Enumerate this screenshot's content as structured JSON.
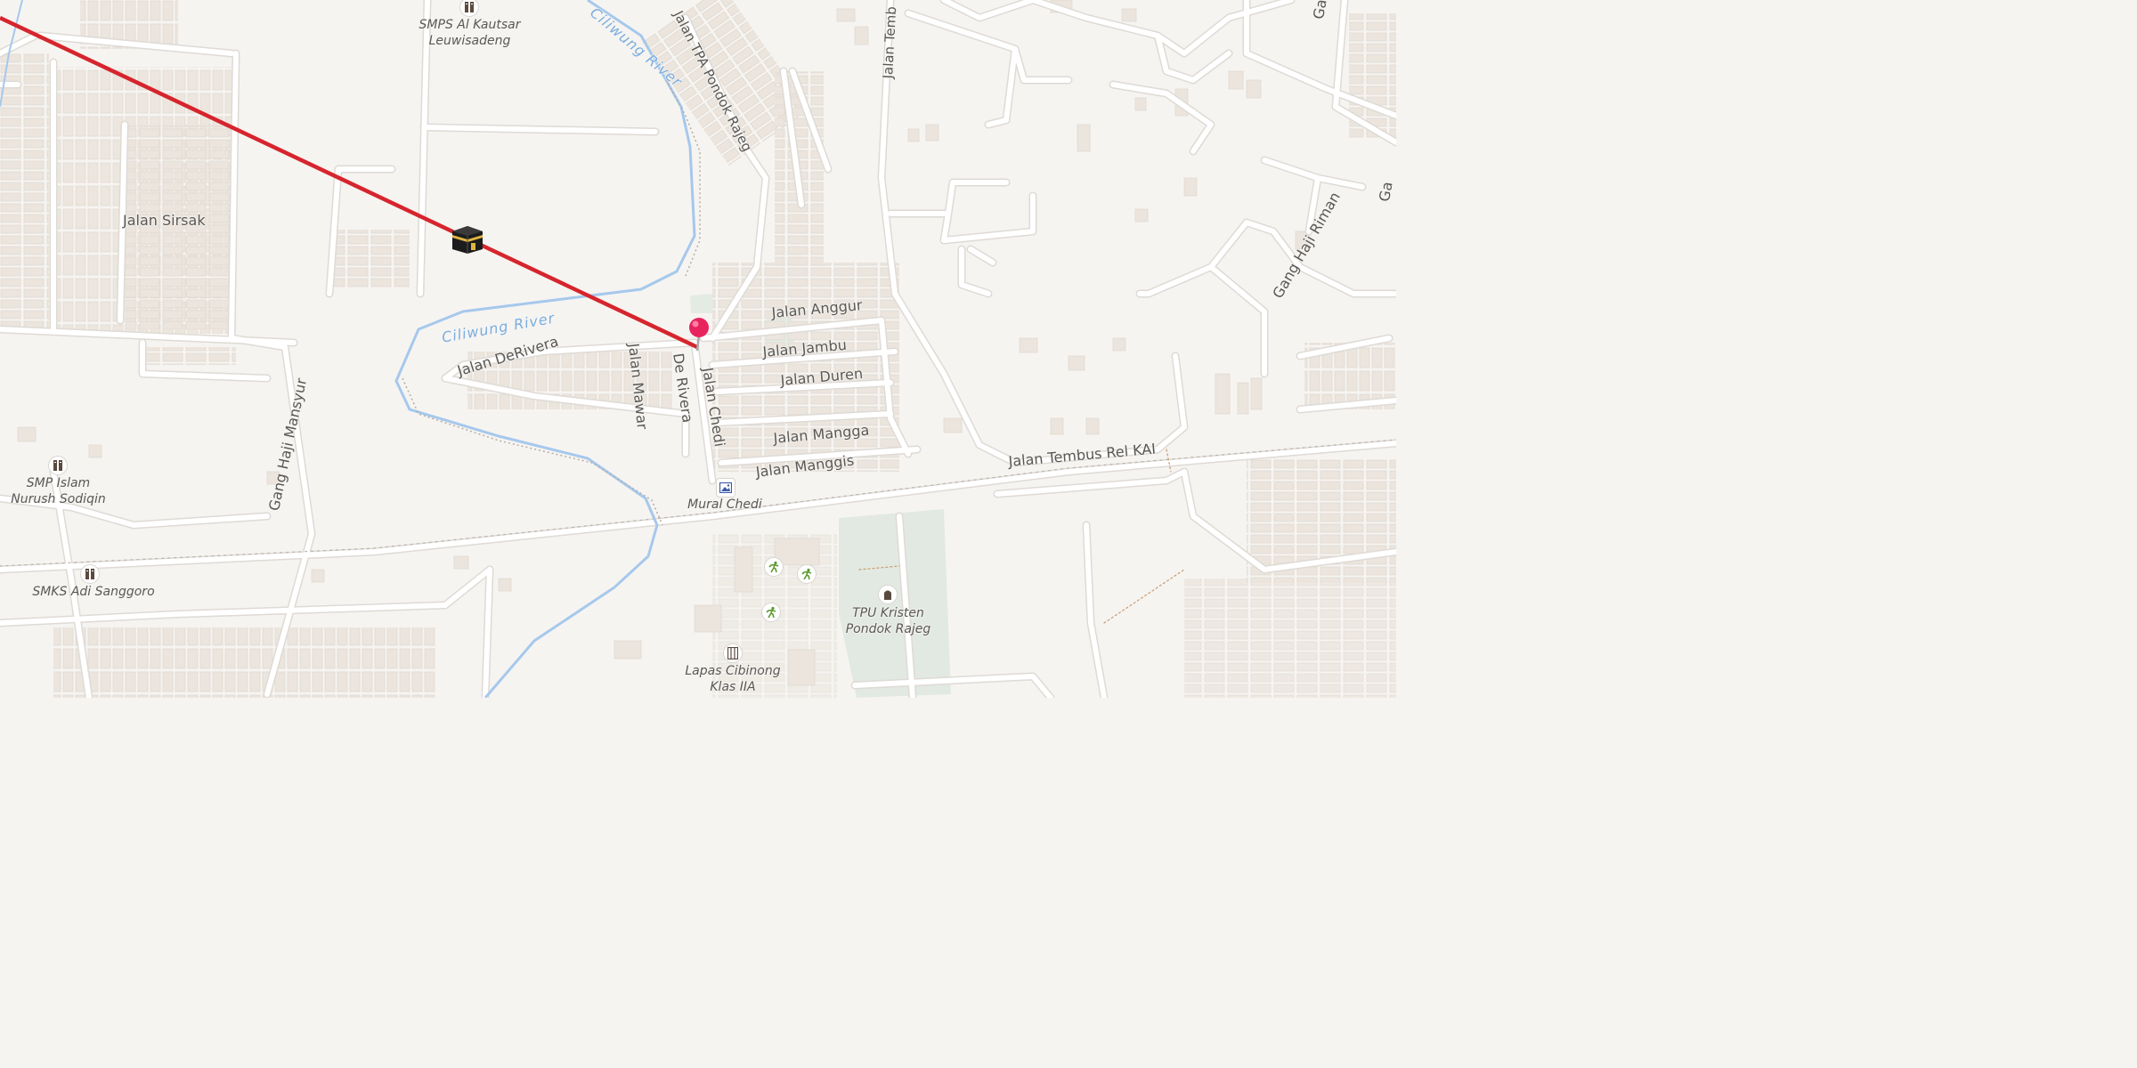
{
  "map": {
    "streets": {
      "jalan_sirsak": "Jalan Sirsak",
      "jalan_tpa_pondok_rajeg": "Jalan TPA Pondok Rajeg",
      "jalan_temb": "Jalan Temb",
      "jalan_anggur": "Jalan Anggur",
      "jalan_jambu": "Jalan Jambu",
      "jalan_duren": "Jalan Duren",
      "jalan_mangga": "Jalan Mangga",
      "jalan_manggis": "Jalan Manggis",
      "jalan_derivera": "Jalan DeRivera",
      "jalan_mawar": "Jalan Mawar",
      "de_rivera": "De Rivera",
      "jalan_chedi": "Jalan Chedi",
      "jalan_tembus_rel_kai": "Jalan Tembus Rel KAI",
      "gang_haji_mansyur": "Gang Haji Mansyur",
      "gang_haji_riman": "Gang Haji Riman",
      "top_right_fragment": "Ga",
      "right_edge_fragment": "Ga"
    },
    "rivers": {
      "ciliwung_upper": "Ciliwung River",
      "ciliwung_lower": "Ciliwung River"
    },
    "pois": {
      "smps_al_kautsar": "SMPS Al Kautsar Leuwisadeng",
      "smp_islam": "SMP Islam Nurush Sodiqin",
      "smks_adi_sanggoro": "SMKS Adi Sanggoro",
      "mural_chedi": "Mural Chedi",
      "tpu_kristen": "TPU Kristen Pondok Rajeg",
      "lapas_cibinong": "Lapas Cibinong Klas IIA"
    },
    "colors": {
      "land": "#f6f4f1",
      "road": "#ffffff",
      "road_casing": "#dedad5",
      "building": "#ebe5dd",
      "river": "#a6c8ec",
      "qibla_line": "#d6252d",
      "pin": "#e8245f",
      "cemetery": "#e2e9e2"
    },
    "icons": {
      "qibla": "kaaba-icon",
      "pin": "location-pin-icon",
      "school": "school-icon",
      "art": "art-gallery-icon",
      "sport": "running-icon",
      "cemetery": "grave-icon",
      "prison": "prison-icon"
    }
  }
}
